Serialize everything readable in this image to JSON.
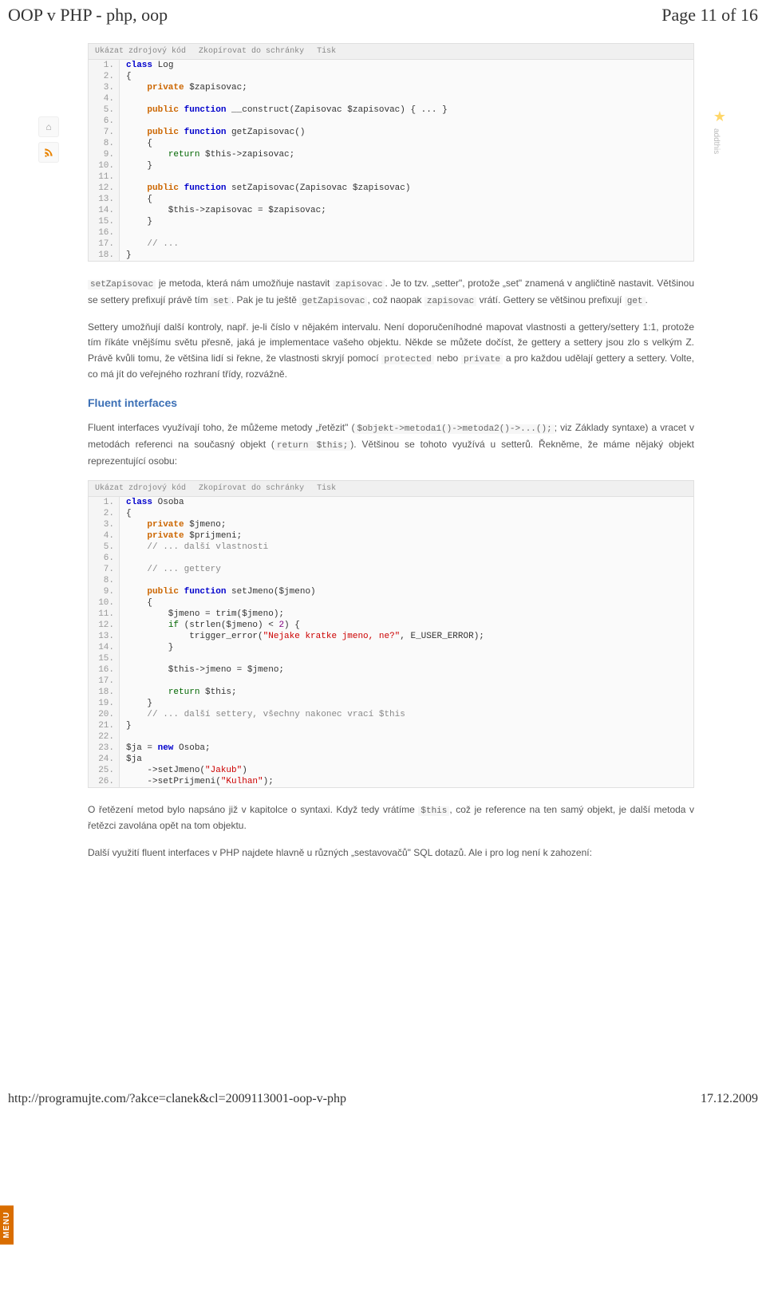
{
  "header": {
    "title": "OOP v PHP - php, oop",
    "page_info": "Page 11 of 16"
  },
  "side_icons": {
    "home_title": "Home",
    "rss_title": "RSS"
  },
  "side_right": {
    "star_title": "Oblíbené",
    "label": "addthis"
  },
  "toolbar": {
    "show_source": "Ukázat zdrojový kód",
    "copy": "Zkopírovat do schránky",
    "print": "Tisk"
  },
  "code1": {
    "l1a": "class",
    "l1b": " Log",
    "l2": "{",
    "l3a": "    ",
    "l3b": "private",
    "l3c": " $zapisovac;",
    "l4": " ",
    "l5a": "    ",
    "l5b": "public",
    "l5c": " ",
    "l5d": "function",
    "l5e": " __construct(Zapisovac $zapisovac) { ... }",
    "l6": " ",
    "l7a": "    ",
    "l7b": "public",
    "l7c": " ",
    "l7d": "function",
    "l7e": " getZapisovac()",
    "l8": "    {",
    "l9a": "        ",
    "l9b": "return",
    "l9c": " $this->zapisovac;",
    "l10": "    }",
    "l11": " ",
    "l12a": "    ",
    "l12b": "public",
    "l12c": " ",
    "l12d": "function",
    "l12e": " setZapisovac(Zapisovac $zapisovac)",
    "l13": "    {",
    "l14": "        $this->zapisovac = $zapisovac;",
    "l15": "    }",
    "l16": " ",
    "l17a": "    ",
    "l17b": "// ...",
    "l18": "}"
  },
  "para1": {
    "t1": "setZapisovac",
    "t2": " je metoda, která nám umožňuje nastavit ",
    "t3": "zapisovac",
    "t4": ". Je to tzv. „setter\", protože „set\" znamená v angličtině nastavit. Většinou se settery prefixují právě tím ",
    "t5": "set",
    "t6": ". Pak je tu ještě ",
    "t7": "getZapisovac",
    "t8": ", což naopak ",
    "t9": "zapisovac",
    "t10": " vrátí. Gettery se většinou prefixují ",
    "t11": "get",
    "t12": "."
  },
  "para2": "Settery umožňují další kontroly, např. je-li číslo v nějakém intervalu. Není doporučeníhodné mapovat vlastnosti a gettery/settery 1:1, protože tím říkáte vnějšímu světu přesně, jaká je implementace vašeho objektu. Někde se můžete dočíst, že gettery a settery jsou zlo s velkým Z. Právě kvůli tomu, že většina lidí si řekne, že vlastnosti skryjí pomocí ",
  "para2b": " nebo ",
  "para2c": " a pro každou udělají gettery a settery. Volte, co má jít do veřejného rozhraní třídy, rozvážně.",
  "para2_code1": "protected",
  "para2_code2": "private",
  "section_title": "Fluent interfaces",
  "para3": {
    "t1": "Fluent interfaces využívají toho, že můžeme metody „řetězit\" (",
    "t2": "$objekt->metoda1()->metoda2()->...();",
    "t3": "; viz Základy syntaxe) a vracet v metodách referenci na současný objekt (",
    "t4": "return $this;",
    "t5": "). Většinou se tohoto využívá u setterů. Řekněme, že máme nějaký objekt reprezentující osobu:"
  },
  "code2": {
    "l1a": "class",
    "l1b": " Osoba",
    "l2": "{",
    "l3a": "    ",
    "l3b": "private",
    "l3c": " $jmeno;",
    "l4a": "    ",
    "l4b": "private",
    "l4c": " $prijmeni;",
    "l5a": "    ",
    "l5b": "// ... další vlastnosti",
    "l6": " ",
    "l7a": "    ",
    "l7b": "// ... gettery",
    "l8": " ",
    "l9a": "    ",
    "l9b": "public",
    "l9c": " ",
    "l9d": "function",
    "l9e": " setJmeno($jmeno)",
    "l10": "    {",
    "l11": "        $jmeno = trim($jmeno);",
    "l12a": "        ",
    "l12b": "if",
    "l12c": " (strlen($jmeno) < ",
    "l12d": "2",
    "l12e": ") {",
    "l13a": "            trigger_error(",
    "l13b": "\"Nejake kratke jmeno, ne?\"",
    "l13c": ", E_USER_ERROR);",
    "l14": "        }",
    "l15": " ",
    "l16": "        $this->jmeno = $jmeno;",
    "l17": " ",
    "l18a": "        ",
    "l18b": "return",
    "l18c": " $this;",
    "l19": "    }",
    "l20a": "    ",
    "l20b": "// ... další settery, všechny nakonec vrací $this",
    "l21": "}",
    "l22": " ",
    "l23a": "$ja = ",
    "l23b": "new",
    "l23c": " Osoba;",
    "l24": "$ja",
    "l25a": "    ->setJmeno(",
    "l25b": "\"Jakub\"",
    "l25c": ")",
    "l26a": "    ->setPrijmeni(",
    "l26b": "\"Kulhan\"",
    "l26c": ");"
  },
  "para4": {
    "t1": "O řetězení metod bylo napsáno již v kapitolce o syntaxi. Když tedy vrátíme ",
    "t2": "$this",
    "t3": ", což je reference na ten samý objekt, je další metoda v řetězci zavolána opět na tom objektu."
  },
  "para5": "Další využití fluent interfaces v PHP najdete hlavně u různých „sestavovačů\" SQL dotazů. Ale i pro log není k zahození:",
  "menu_tab": "MENU",
  "footer": {
    "url": "http://programujte.com/?akce=clanek&cl=2009113001-oop-v-php",
    "date": "17.12.2009"
  }
}
